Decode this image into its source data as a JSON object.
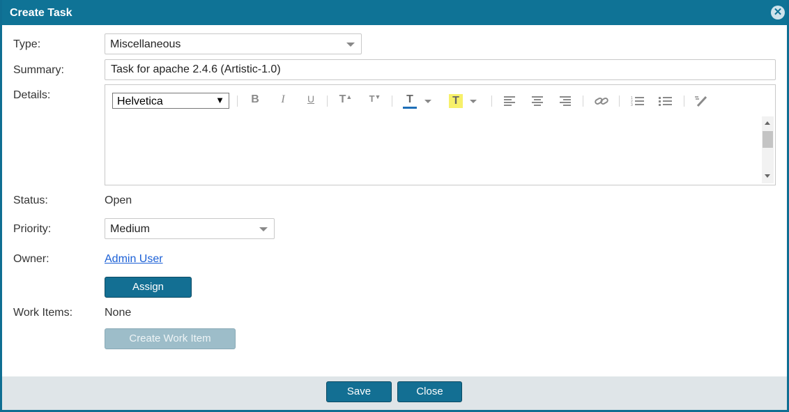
{
  "dialog": {
    "title": "Create Task",
    "close_glyph": "✕"
  },
  "form": {
    "type_label": "Type:",
    "type_value": "Miscellaneous",
    "summary_label": "Summary:",
    "summary_value": "Task for apache 2.4.6 (Artistic-1.0)",
    "details_label": "Details:",
    "status_label": "Status:",
    "status_value": "Open",
    "priority_label": "Priority:",
    "priority_value": "Medium",
    "owner_label": "Owner:",
    "owner_value": "Admin User",
    "assign_button": "Assign",
    "work_items_label": "Work Items:",
    "work_items_value": "None",
    "create_work_item_button": "Create Work Item"
  },
  "editor": {
    "font": "Helvetica",
    "font_caret": "▼",
    "toolbar": {
      "bold": "B",
      "italic": "I",
      "underline": "U",
      "superscript": "T",
      "subscript": "T",
      "text_color": "T",
      "highlight": "T"
    },
    "colors": {
      "text_color_bar": "#1e6fb8",
      "highlight_bg": "#f7f06a"
    },
    "icons": [
      "bold-icon",
      "italic-icon",
      "underline-icon",
      "superscript-icon",
      "subscript-icon",
      "text-color-icon",
      "highlight-icon",
      "align-left-icon",
      "align-center-icon",
      "align-right-icon",
      "link-icon",
      "ordered-list-icon",
      "unordered-list-icon",
      "clear-format-icon"
    ]
  },
  "footer": {
    "save_button": "Save",
    "close_button": "Close"
  },
  "colors": {
    "titlebar": "#0f7396",
    "primary": "#136f93",
    "footer": "#dfe5e8",
    "link": "#1a5fd6"
  }
}
